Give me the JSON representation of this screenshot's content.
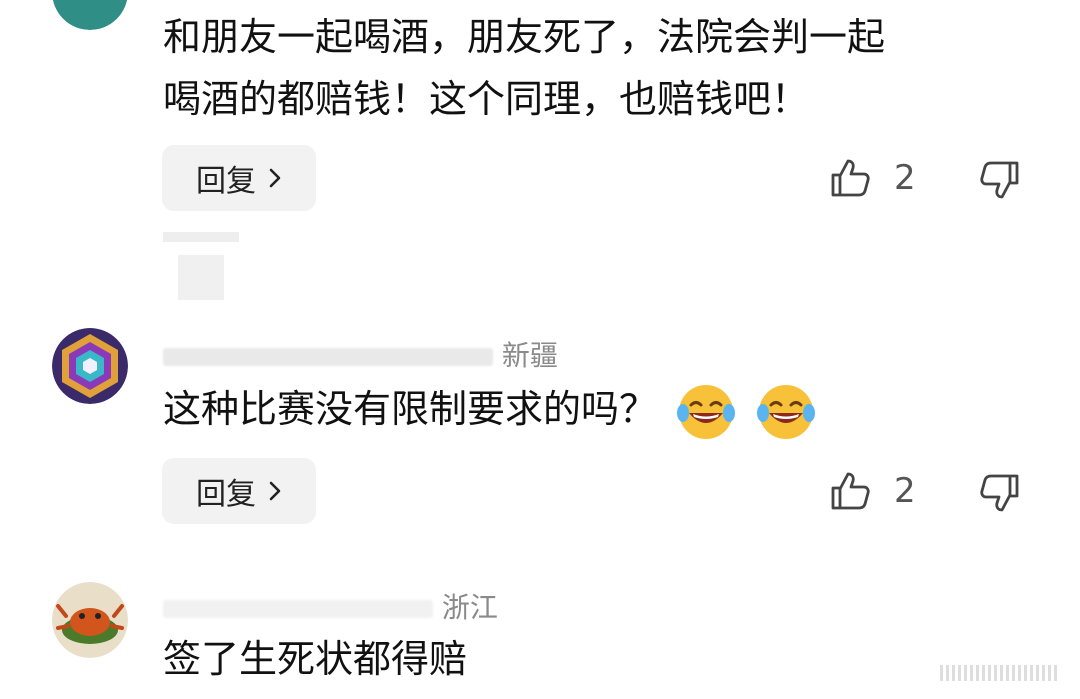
{
  "comments": [
    {
      "text_line1": "和朋友一起喝酒，朋友死了，法院会判一起",
      "text_line2": "喝酒的都赔钱！这个同理，也赔钱吧！",
      "reply_label": "回复",
      "likes": "2"
    },
    {
      "meta_location": "新疆",
      "text": "这种比赛没有限制要求的吗？",
      "reply_label": "回复",
      "likes": "2"
    },
    {
      "meta_location": "浙江",
      "text": "签了生死状都得赔"
    }
  ],
  "colors": {
    "background": "#ffffff",
    "text": "#111111",
    "meta": "#8a8a8a",
    "button_bg": "#f2f2f2"
  },
  "icons": {
    "like": "thumbs-up-icon",
    "dislike": "thumbs-down-icon",
    "reply_chevron": "chevron-right-icon",
    "emoji": "laughing-tears-emoji"
  }
}
